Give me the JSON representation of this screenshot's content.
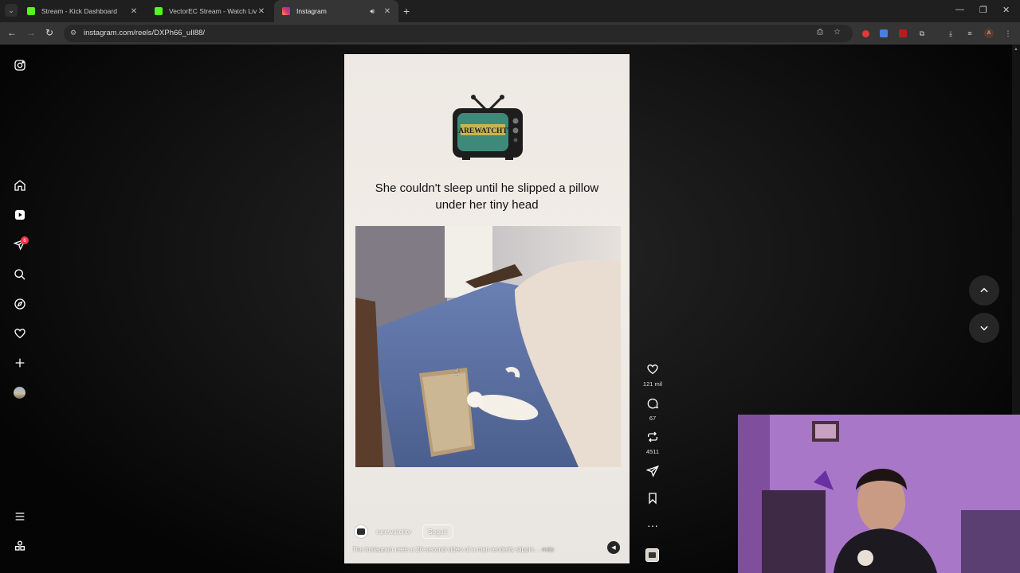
{
  "browser": {
    "tabs": [
      {
        "title": "Stream - Kick Dashboard",
        "favicon_color": "#53fc18",
        "active": false
      },
      {
        "title": "VectorEC Stream - Watch Live o",
        "favicon_color": "#53fc18",
        "active": false
      },
      {
        "title": "Instagram",
        "favicon_color": "#e1306c",
        "active": true
      }
    ],
    "url": "instagram.com/reels/DXPh66_uIl88/"
  },
  "sidebar": {
    "items": [
      {
        "name": "instagram-logo-icon"
      },
      {
        "name": "home-icon"
      },
      {
        "name": "reels-icon"
      },
      {
        "name": "messages-icon",
        "badge": "6"
      },
      {
        "name": "search-icon"
      },
      {
        "name": "explore-icon"
      },
      {
        "name": "notifications-icon"
      },
      {
        "name": "create-icon"
      },
      {
        "name": "profile-avatar"
      },
      {
        "name": "more-menu-icon"
      },
      {
        "name": "also-from-meta-icon"
      }
    ]
  },
  "reel": {
    "logo_text": "RAREWATCHTV",
    "caption": "She couldn't sleep until he slipped a pillow under her tiny head",
    "author": "rarewatchtv",
    "follow_label": "Seguir",
    "description": "The Instagram reels a 20-second video of a man tenderly slippin…",
    "more_label": "más"
  },
  "actions": {
    "likes": "121 mil",
    "comments": "67",
    "reposts": "4511"
  },
  "colors": {
    "accent": "#ff3040",
    "background": "#000000",
    "card_bg": "#efeae5",
    "tv_screen": "#3e8a7a"
  }
}
